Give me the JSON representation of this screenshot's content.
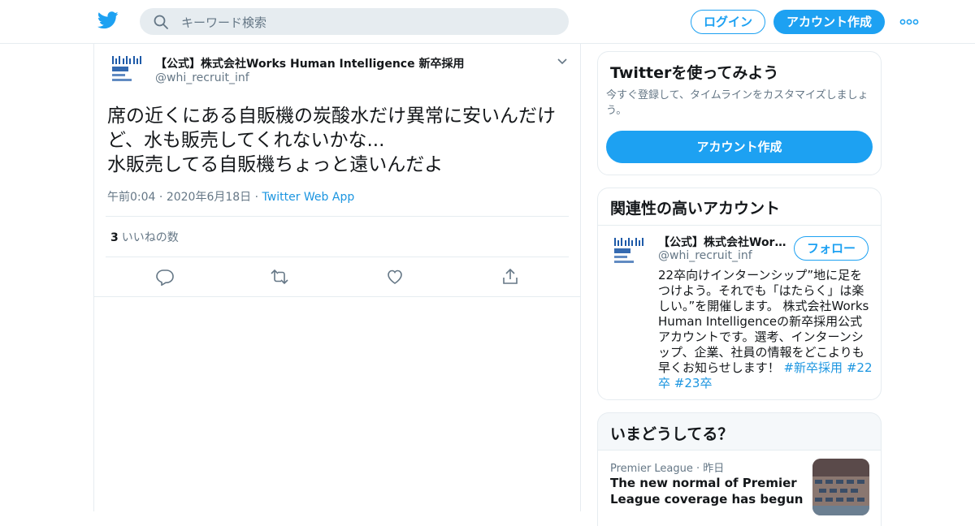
{
  "header": {
    "search_placeholder": "キーワード検索",
    "login_label": "ログイン",
    "signup_label": "アカウント作成"
  },
  "tweet": {
    "author_name": "【公式】株式会社Works Human Intelligence 新卒採用",
    "author_handle": "@whi_recruit_inf",
    "text_lines": [
      "席の近くにある自販機の炭酸水だけ異常に安いんだけ",
      "ど、水も販売してくれないかな...",
      "水販売してる自販機ちょっと遠いんだよ"
    ],
    "time": "午前0:04",
    "date": "2020年6月18日",
    "source": "Twitter Web App",
    "likes_count": "3",
    "likes_label": "いいねの数"
  },
  "signup_card": {
    "title": "Twitterを使ってみよう",
    "description": "今すぐ登録して、タイムラインをカスタマイズしましょう。",
    "button_label": "アカウント作成"
  },
  "related_card": {
    "title": "関連性の高いアカウント",
    "account_name": "【公式】株式会社Works Human Intelligence 新卒採用",
    "account_handle": "@whi_recruit_inf",
    "follow_label": "フォロー",
    "bio_text": "22卒向けインターンシップ”地に足をつけよう。それでも「はたらく」は楽しい。”を開催します。 株式会社Works Human Intelligenceの新卒採用公式アカウントです。選考、インターンシップ、企業、社員の情報をどこよりも早くお知らせします！",
    "bio_tags": [
      "#新卒採用",
      "#22卒",
      "#23卒"
    ]
  },
  "trends_card": {
    "title": "いまどうしてる？",
    "trend_category": "Premier League",
    "trend_time": "昨日",
    "trend_headline": "The new normal of Premier League coverage has begun"
  },
  "colors": {
    "brand_blue": "#1da1f2",
    "link_blue": "#1b95e0",
    "muted_text": "#657786",
    "border": "#e6ecf0"
  },
  "icons": [
    "twitter-bird-icon",
    "search-icon",
    "more-dots-icon",
    "chevron-down-icon",
    "reply-icon",
    "retweet-icon",
    "like-icon",
    "share-icon"
  ]
}
